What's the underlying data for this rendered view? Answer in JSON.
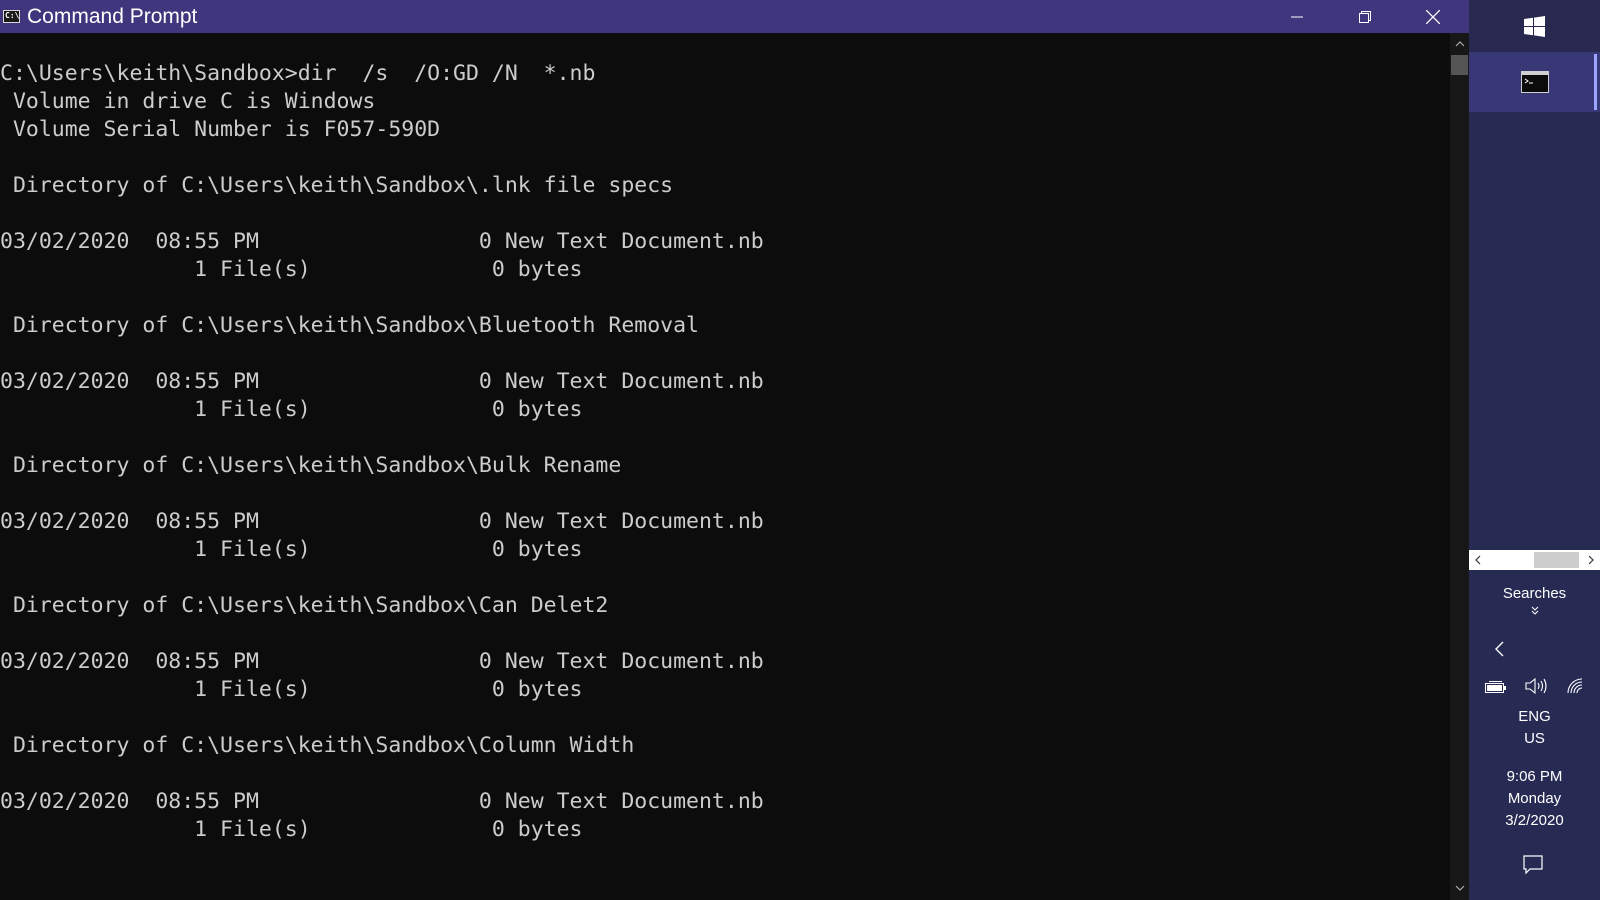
{
  "window": {
    "title": "Command Prompt",
    "icon_label": "C:\\",
    "controls": [
      "minimize",
      "restore",
      "close"
    ]
  },
  "console": {
    "lines": [
      "C:\\Users\\keith\\Sandbox>dir  /s  /O:GD /N  *.nb",
      " Volume in drive C is Windows",
      " Volume Serial Number is F057-590D",
      "",
      " Directory of C:\\Users\\keith\\Sandbox\\.lnk file specs",
      "",
      "03/02/2020  08:55 PM                 0 New Text Document.nb",
      "               1 File(s)              0 bytes",
      "",
      " Directory of C:\\Users\\keith\\Sandbox\\Bluetooth Removal",
      "",
      "03/02/2020  08:55 PM                 0 New Text Document.nb",
      "               1 File(s)              0 bytes",
      "",
      " Directory of C:\\Users\\keith\\Sandbox\\Bulk Rename",
      "",
      "03/02/2020  08:55 PM                 0 New Text Document.nb",
      "               1 File(s)              0 bytes",
      "",
      " Directory of C:\\Users\\keith\\Sandbox\\Can Delet2",
      "",
      "03/02/2020  08:55 PM                 0 New Text Document.nb",
      "               1 File(s)              0 bytes",
      "",
      " Directory of C:\\Users\\keith\\Sandbox\\Column Width",
      "",
      "03/02/2020  08:55 PM                 0 New Text Document.nb",
      "               1 File(s)              0 bytes"
    ],
    "text_color": "#cccccc",
    "background": "#0c0c0c"
  },
  "taskbar": {
    "start_icon": "windows-logo-icon",
    "pinned_app_icon": "command-prompt-icon",
    "searches_label": "Searches",
    "tray": {
      "icons": [
        "chevron-left-icon",
        "battery-icon",
        "volume-icon",
        "network-icon"
      ],
      "language": "ENG",
      "region": "US"
    },
    "clock": {
      "time": "9:06 PM",
      "day": "Monday",
      "date": "3/2/2020"
    },
    "notification_icon": "action-center-icon"
  },
  "colors": {
    "titlebar": "#3f367d",
    "taskbar": "#272a53",
    "taskbar_active": "#383877"
  }
}
